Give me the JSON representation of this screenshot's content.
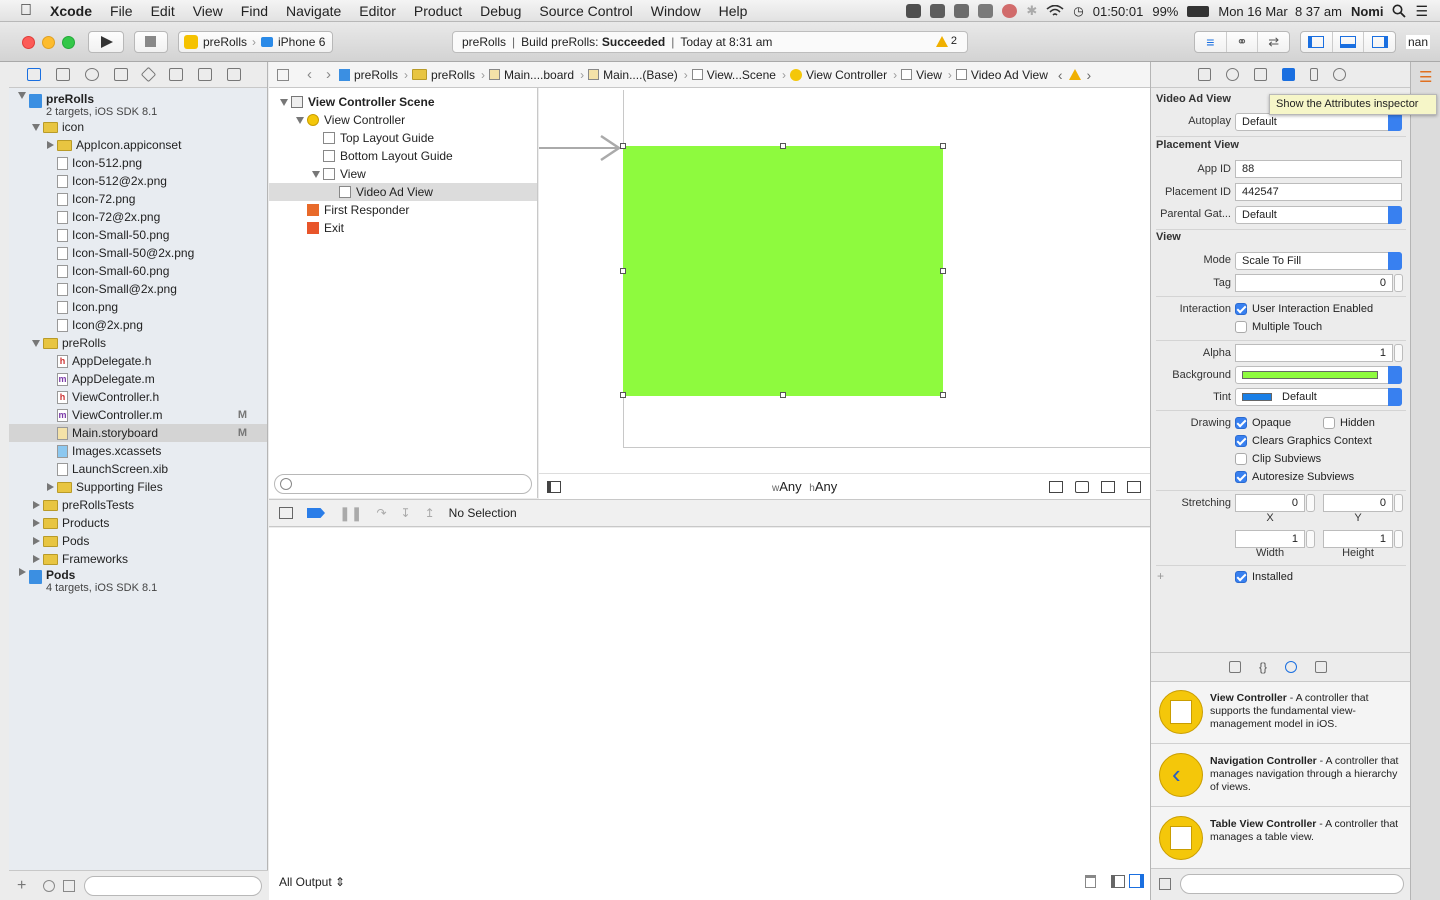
{
  "menubar": {
    "app": "Xcode",
    "items": [
      "File",
      "Edit",
      "View",
      "Find",
      "Navigate",
      "Editor",
      "Product",
      "Debug",
      "Source Control",
      "Window",
      "Help"
    ],
    "time_elapsed": "01:50:01",
    "battery": "99%",
    "clock": "Mon 16 Mar  8 37 am",
    "user": "Nomi"
  },
  "toolbar": {
    "scheme": "preRolls",
    "device": "iPhone 6",
    "activity_project": "preRolls",
    "activity_build": "Build preRolls:",
    "activity_status": "Succeeded",
    "activity_time": "Today at 8:31 am",
    "warning_count": "2",
    "right_cut_text": "nan"
  },
  "navigator": {
    "rows": [
      {
        "label": "preRolls",
        "sub": "2 targets, iOS SDK 8.1",
        "kind": "project",
        "indent": 0,
        "disc": "open"
      },
      {
        "label": "icon",
        "kind": "folder",
        "indent": 1,
        "disc": "open"
      },
      {
        "label": "AppIcon.appiconset",
        "kind": "folder",
        "indent": 2,
        "disc": "closed"
      },
      {
        "label": "Icon-512.png",
        "kind": "file",
        "indent": 2
      },
      {
        "label": "Icon-512@2x.png",
        "kind": "file",
        "indent": 2
      },
      {
        "label": "Icon-72.png",
        "kind": "file",
        "indent": 2
      },
      {
        "label": "Icon-72@2x.png",
        "kind": "file",
        "indent": 2
      },
      {
        "label": "Icon-Small-50.png",
        "kind": "file",
        "indent": 2
      },
      {
        "label": "Icon-Small-50@2x.png",
        "kind": "file",
        "indent": 2
      },
      {
        "label": "Icon-Small-60.png",
        "kind": "file",
        "indent": 2
      },
      {
        "label": "Icon-Small@2x.png",
        "kind": "file",
        "indent": 2
      },
      {
        "label": "Icon.png",
        "kind": "file",
        "indent": 2
      },
      {
        "label": "Icon@2x.png",
        "kind": "file",
        "indent": 2
      },
      {
        "label": "preRolls",
        "kind": "folder",
        "indent": 1,
        "disc": "open"
      },
      {
        "label": "AppDelegate.h",
        "kind": "h",
        "indent": 2
      },
      {
        "label": "AppDelegate.m",
        "kind": "m",
        "indent": 2
      },
      {
        "label": "ViewController.h",
        "kind": "h",
        "indent": 2
      },
      {
        "label": "ViewController.m",
        "kind": "m",
        "indent": 2,
        "badge": "M"
      },
      {
        "label": "Main.storyboard",
        "kind": "storyboard",
        "indent": 2,
        "badge": "M",
        "selected": true
      },
      {
        "label": "Images.xcassets",
        "kind": "assets",
        "indent": 2
      },
      {
        "label": "LaunchScreen.xib",
        "kind": "file",
        "indent": 2
      },
      {
        "label": "Supporting Files",
        "kind": "folder",
        "indent": 2,
        "disc": "closed"
      },
      {
        "label": "preRollsTests",
        "kind": "folder",
        "indent": 1,
        "disc": "closed"
      },
      {
        "label": "Products",
        "kind": "folder",
        "indent": 1,
        "disc": "closed"
      },
      {
        "label": "Pods",
        "kind": "folder",
        "indent": 1,
        "disc": "closed"
      },
      {
        "label": "Frameworks",
        "kind": "folder",
        "indent": 1,
        "disc": "closed"
      },
      {
        "label": "Pods",
        "sub": "4 targets, iOS SDK 8.1",
        "kind": "project",
        "indent": 0,
        "disc": "closed"
      }
    ]
  },
  "jumpbar": {
    "crumbs": [
      "preRolls",
      "preRolls",
      "Main....board",
      "Main....(Base)",
      "View...Scene",
      "View Controller",
      "View",
      "Video Ad View"
    ]
  },
  "outline": {
    "rows": [
      {
        "label": "View Controller Scene",
        "indent": 0,
        "bold": true,
        "disc": "open",
        "icon": "scene"
      },
      {
        "label": "View Controller",
        "indent": 1,
        "disc": "open",
        "icon": "vc"
      },
      {
        "label": "Top Layout Guide",
        "indent": 2,
        "icon": "box"
      },
      {
        "label": "Bottom Layout Guide",
        "indent": 2,
        "icon": "box"
      },
      {
        "label": "View",
        "indent": 2,
        "disc": "open",
        "icon": "box"
      },
      {
        "label": "Video Ad View",
        "indent": 3,
        "icon": "box",
        "selected": true
      },
      {
        "label": "First Responder",
        "indent": 1,
        "icon": "responder"
      },
      {
        "label": "Exit",
        "indent": 1,
        "icon": "exit"
      }
    ]
  },
  "canvas": {
    "adview_color": "#8efa3e",
    "size_w_prefix": "w",
    "size_w": "Any",
    "size_h_prefix": "h",
    "size_h": "Any"
  },
  "debug": {
    "no_selection": "No Selection",
    "output_filter": "All Output"
  },
  "inspector": {
    "section_video": "Video Ad View",
    "autoplay_label": "Autoplay",
    "autoplay_value": "Default",
    "section_placement": "Placement View",
    "appid_label": "App ID",
    "appid_value": "88",
    "placementid_label": "Placement ID",
    "placementid_value": "442547",
    "parental_label": "Parental Gat...",
    "parental_value": "Default",
    "section_view": "View",
    "mode_label": "Mode",
    "mode_value": "Scale To Fill",
    "tag_label": "Tag",
    "tag_value": "0",
    "interaction_label": "Interaction",
    "user_interaction": "User Interaction Enabled",
    "multiple_touch": "Multiple Touch",
    "alpha_label": "Alpha",
    "alpha_value": "1",
    "background_label": "Background",
    "background_color": "#8efa3e",
    "tint_label": "Tint",
    "tint_value": "Default",
    "tint_color": "#1a7fe6",
    "drawing_label": "Drawing",
    "opaque": "Opaque",
    "hidden": "Hidden",
    "clears": "Clears Graphics Context",
    "clip": "Clip Subviews",
    "autoresize": "Autoresize Subviews",
    "stretching_label": "Stretching",
    "stretch_x": "0",
    "stretch_y": "0",
    "stretch_x_cap": "X",
    "stretch_y_cap": "Y",
    "stretch_w": "1",
    "stretch_h": "1",
    "stretch_w_cap": "Width",
    "stretch_h_cap": "Height",
    "installed": "Installed",
    "tooltip": "Show the Attributes inspector"
  },
  "library": {
    "items": [
      {
        "title": "View Controller",
        "desc": " - A controller that supports the fundamental view-management model in iOS."
      },
      {
        "title": "Navigation Controller",
        "desc": " - A controller that manages navigation through a hierarchy of views."
      },
      {
        "title": "Table View Controller",
        "desc": " - A controller that manages a table view."
      }
    ]
  }
}
